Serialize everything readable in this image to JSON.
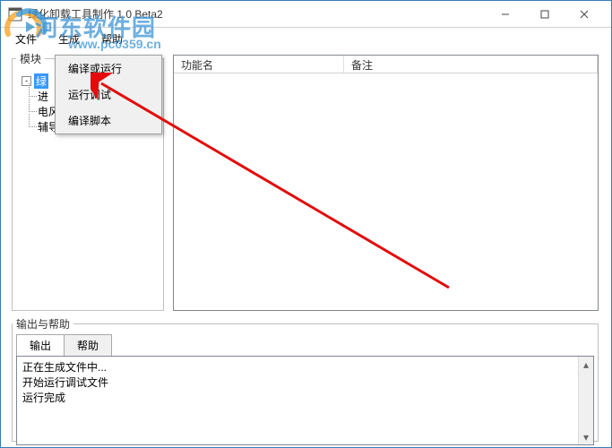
{
  "titlebar": {
    "title": "绿化卸载工具制作 1.0 Beta2"
  },
  "menubar": {
    "items": [
      "文件",
      "生成",
      "帮助"
    ]
  },
  "tree": {
    "legend": "模块",
    "root": "绿",
    "children": [
      "进",
      "电风扇",
      "辅导费"
    ],
    "expander": "-"
  },
  "contextMenu": {
    "items": [
      "编译或运行",
      "运行调试",
      "编译脚本"
    ]
  },
  "listview": {
    "columns": [
      "功能名",
      "备注"
    ]
  },
  "output": {
    "legend": "输出与帮助",
    "tabs": [
      "输出",
      "帮助"
    ],
    "lines": "正在生成文件中...\n开始运行调试文件\n运行完成"
  },
  "watermark": {
    "brand": "河东软件园",
    "url": "www.pc0359.cn"
  },
  "scroll": {
    "up": "▴",
    "down": "▾"
  }
}
